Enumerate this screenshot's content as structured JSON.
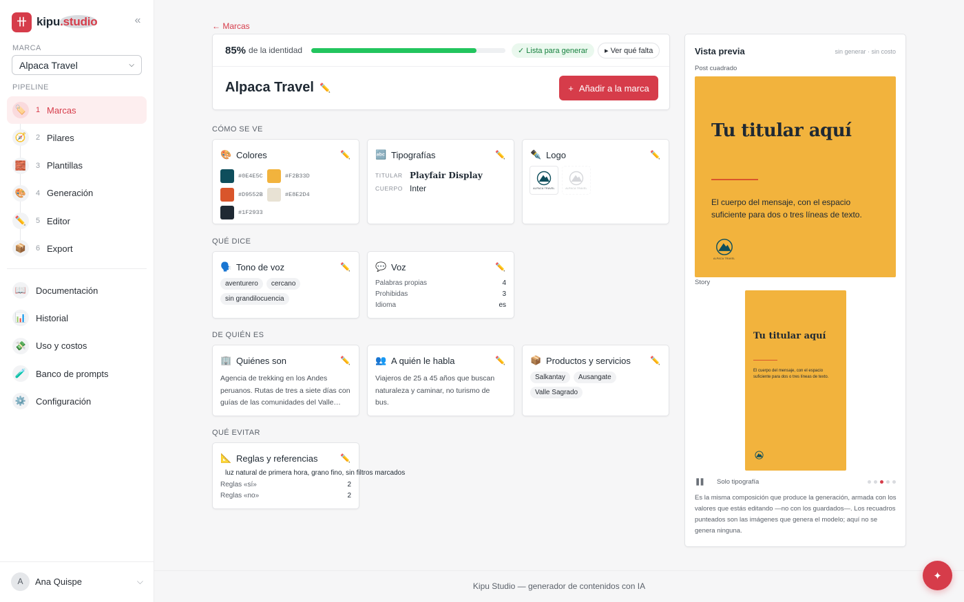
{
  "app": {
    "name_main": "kipu",
    "name_dot": ".studio",
    "logo_glyph": "卄",
    "collapse_icon": "«"
  },
  "sidebar": {
    "marca_label": "MARCA",
    "marca_value": "Alpaca Travel",
    "pipeline_label": "PIPELINE",
    "pipeline": [
      {
        "num": "1",
        "label": "Marcas",
        "icon": "🏷️",
        "active": true
      },
      {
        "num": "2",
        "label": "Pilares",
        "icon": "🧭"
      },
      {
        "num": "3",
        "label": "Plantillas",
        "icon": "🧱"
      },
      {
        "num": "4",
        "label": "Generación",
        "icon": "🎨"
      },
      {
        "num": "5",
        "label": "Editor",
        "icon": "✏️"
      },
      {
        "num": "6",
        "label": "Export",
        "icon": "📦"
      }
    ],
    "links": [
      {
        "label": "Documentación",
        "icon": "📖"
      },
      {
        "label": "Historial",
        "icon": "📊"
      },
      {
        "label": "Uso y costos",
        "icon": "💸"
      },
      {
        "label": "Banco de prompts",
        "icon": "🧪"
      },
      {
        "label": "Configuración",
        "icon": "⚙️"
      }
    ],
    "user": {
      "initial": "A",
      "name": "Ana Quispe"
    }
  },
  "main": {
    "back_link": "← Marcas",
    "identity": {
      "percent": "85%",
      "percent_label": "de la identidad",
      "progress": 0.85,
      "ready_badge": "✓ Lista para generar",
      "missing_button": "▸ Ver qué falta",
      "brand_name": "Alpaca Travel",
      "add_button": "Añadir a la marca"
    },
    "sections": {
      "como_se_ve": "CÓMO SE VE",
      "que_dice": "QUÉ DICE",
      "de_quien_es": "DE QUIÉN ES",
      "que_evitar": "QUÉ EVITAR"
    },
    "colores": {
      "title": "Colores",
      "icon": "🎨",
      "swatches": [
        "#0E4E5C",
        "#F2B33D",
        "#D9552B",
        "#E8E2D4",
        "#1F2933"
      ]
    },
    "tipografias": {
      "title": "Tipografías",
      "icon": "🔤",
      "titular_label": "TITULAR",
      "titular_value": "Playfair Display",
      "cuerpo_label": "CUERPO",
      "cuerpo_value": "Inter"
    },
    "logo": {
      "title": "Logo",
      "icon": "✒️",
      "caption": "ALPACA TRAVEL"
    },
    "tono": {
      "title": "Tono de voz",
      "icon": "🗣️",
      "chips": [
        "aventurero",
        "cercano",
        "sin grandilocuencia"
      ]
    },
    "voz": {
      "title": "Voz",
      "icon": "💬",
      "rows": [
        {
          "k": "Palabras propias",
          "v": "4"
        },
        {
          "k": "Prohibidas",
          "v": "3"
        },
        {
          "k": "Idioma",
          "v": "es"
        }
      ]
    },
    "quienes": {
      "title": "Quiénes son",
      "icon": "🏢",
      "text": "Agencia de trekking en los Andes peruanos. Rutas de tres a siete días con guías de las comunidades del Valle…"
    },
    "a_quien": {
      "title": "A quién le habla",
      "icon": "👥",
      "text": "Viajeros de 25 a 45 años que buscan naturaleza y caminar, no turismo de bus."
    },
    "productos": {
      "title": "Productos y servicios",
      "icon": "📦",
      "chips": [
        "Salkantay",
        "Ausangate",
        "Valle Sagrado"
      ]
    },
    "reglas": {
      "title": "Reglas y referencias",
      "icon": "📐",
      "quote": "luz natural de primera hora, grano fino, sin filtros marcados",
      "rows": [
        {
          "k": "Reglas «sí»",
          "v": "2"
        },
        {
          "k": "Reglas «no»",
          "v": "2"
        }
      ]
    },
    "edit_icon": "✏️"
  },
  "preview": {
    "title": "Vista previa",
    "meta": "sin generar · sin costo",
    "post_label": "Post cuadrado",
    "story_label": "Story",
    "headline": "Tu titular aquí",
    "body": "El cuerpo del mensaje, con el espacio suficiente para dos o tres líneas de texto.",
    "control_label": "Solo tipografía",
    "pause_icon": "❚❚",
    "dots_total": 5,
    "dots_active": 3,
    "note": "Es la misma composición que produce la generación, armada con los valores que estás editando —no con los guardados—. Los recuadros punteados son las imágenes que genera el modelo; aquí no se genera ninguna."
  },
  "footer": "Kipu Studio — generador de contenidos con IA",
  "fab_icon": "✦",
  "colors": {
    "accent": "#d63c4a",
    "progress": "#22c55e",
    "post_bg": "#F2B33D",
    "post_line": "#D9552B",
    "logo_teal": "#0E4E5C"
  }
}
